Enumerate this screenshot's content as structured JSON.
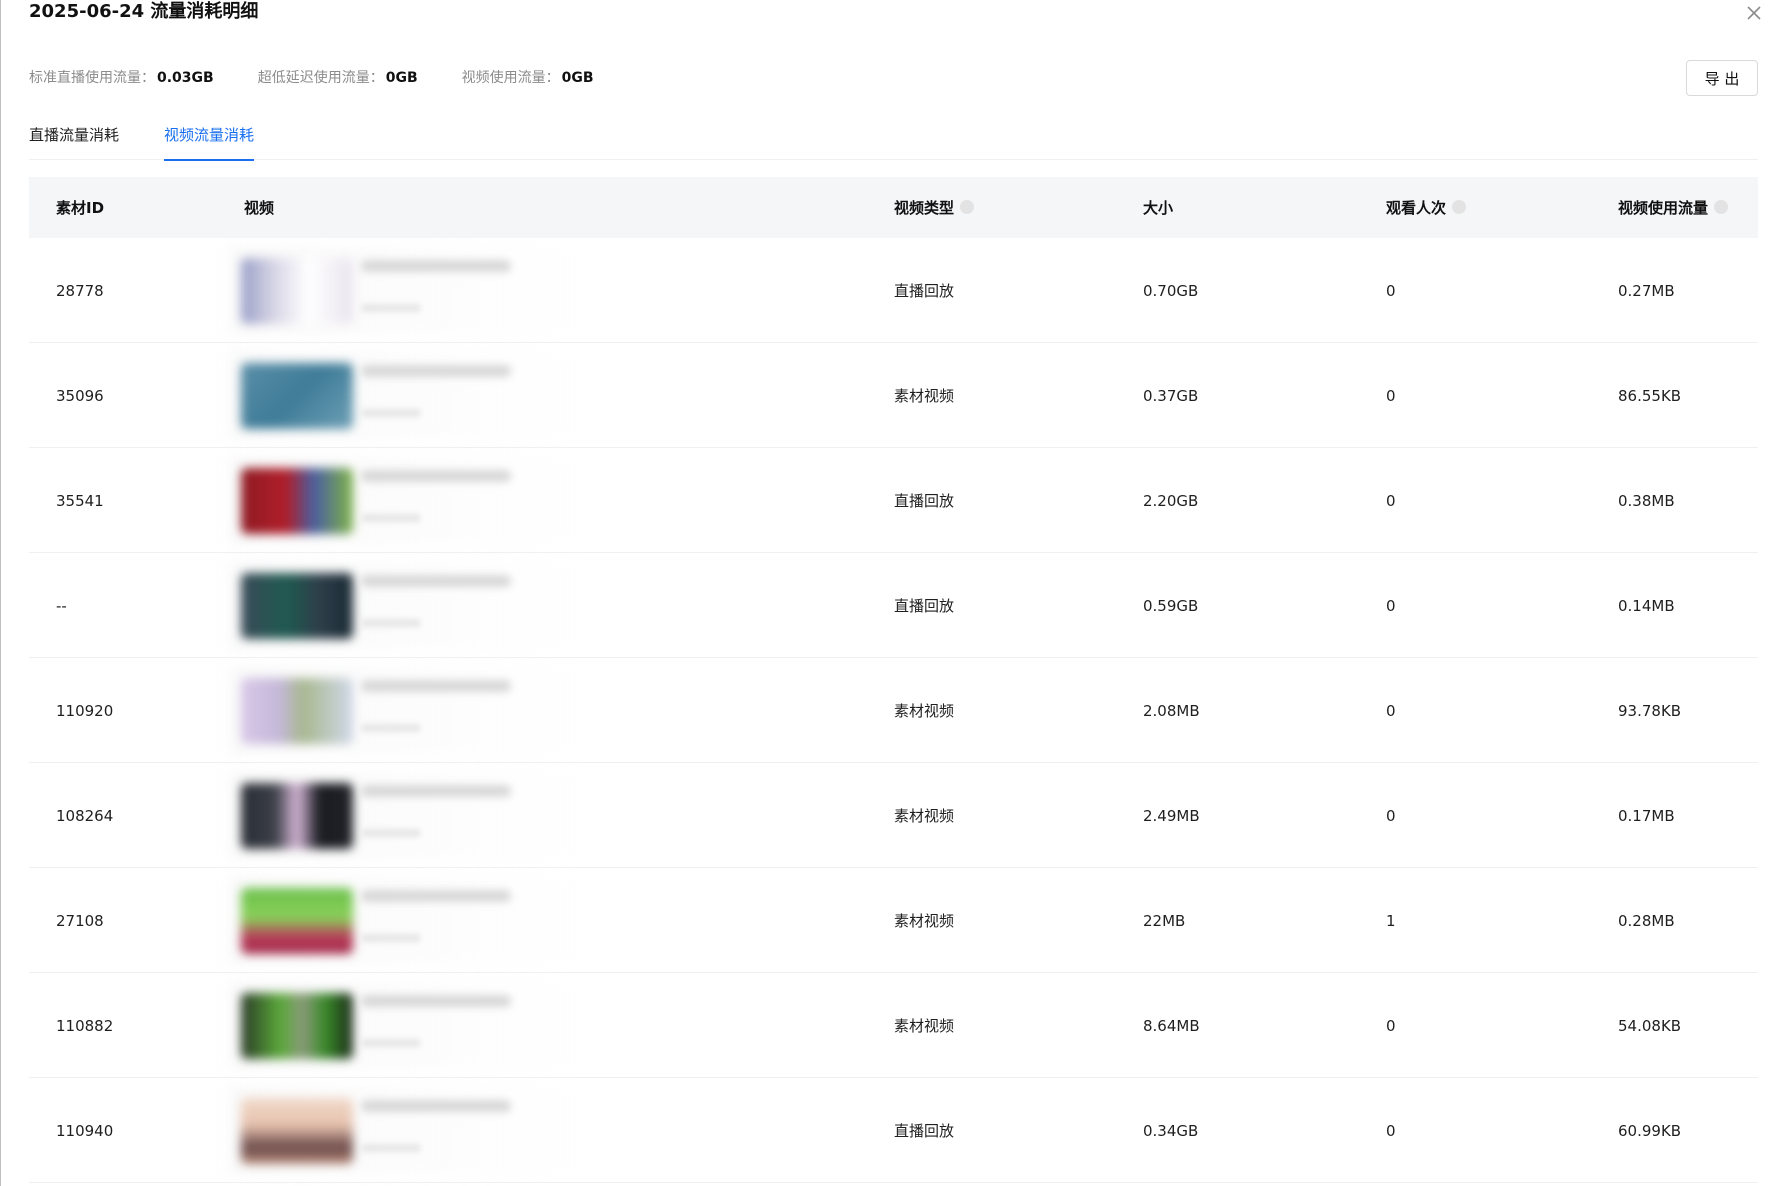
{
  "drawer": {
    "title": "2025-06-24 流量消耗明细",
    "close_icon": "close-icon"
  },
  "summary": [
    {
      "label": "标准直播使用流量：",
      "value": "0.03GB"
    },
    {
      "label": "超低延迟使用流量：",
      "value": "0GB"
    },
    {
      "label": "视频使用流量：",
      "value": "0GB"
    }
  ],
  "export_label": "导 出",
  "tabs": [
    {
      "label": "直播流量消耗",
      "active": false
    },
    {
      "label": "视频流量消耗",
      "active": true
    }
  ],
  "colors": {
    "accent": "#1a6ff0",
    "header_bg": "#f5f6f8"
  },
  "table": {
    "headers": {
      "id": "素材ID",
      "video": "视频",
      "type": "视频类型",
      "size": "大小",
      "views": "观看人次",
      "flow": "视频使用流量"
    },
    "rows": [
      {
        "id": "28778",
        "type": "直播回放",
        "size": "0.70GB",
        "views": "0",
        "flow": "0.27MB",
        "thumb": "linear-gradient(90deg,#9aa0c8 0%,#d8d6e6 30%,#ffffff 60%,#e9e4ee 100%)"
      },
      {
        "id": "35096",
        "type": "素材视频",
        "size": "0.37GB",
        "views": "0",
        "flow": "86.55KB",
        "thumb": "linear-gradient(135deg,#5a8ea8 0%,#3f7c98 50%,#6ea0b6 100%)"
      },
      {
        "id": "35541",
        "type": "直播回放",
        "size": "2.20GB",
        "views": "0",
        "flow": "0.38MB",
        "thumb": "linear-gradient(90deg,#8e1a22 0%,#b01e2a 40%,#4a5fa0 65%,#7fb448 100%)"
      },
      {
        "id": "--",
        "type": "直播回放",
        "size": "0.59GB",
        "views": "0",
        "flow": "0.14MB",
        "thumb": "linear-gradient(90deg,#3a4a58 0%,#1f5a50 40%,#2e3e4a 70%,#1a2a34 100%)"
      },
      {
        "id": "110920",
        "type": "素材视频",
        "size": "2.08MB",
        "views": "0",
        "flow": "93.78KB",
        "thumb": "linear-gradient(90deg,#d8c8e8 0%,#c4b8d8 35%,#a8b890 55%,#d0d8e8 100%)"
      },
      {
        "id": "108264",
        "type": "素材视频",
        "size": "2.49MB",
        "views": "0",
        "flow": "0.17MB",
        "thumb": "linear-gradient(90deg,#2a2e36 0%,#3a3e46 30%,#d6b8d8 50%,#1a1c22 70%,#202228 100%)"
      },
      {
        "id": "27108",
        "type": "素材视频",
        "size": "22MB",
        "views": "1",
        "flow": "0.28MB",
        "thumb": "linear-gradient(180deg,#6ac04a 0%,#8ad05a 45%,#b83a5a 75%,#a02a48 100%)"
      },
      {
        "id": "110882",
        "type": "素材视频",
        "size": "8.64MB",
        "views": "0",
        "flow": "54.08KB",
        "thumb": "linear-gradient(90deg,#2a3a26 0%,#5aa83a 35%,#8a9a7a 55%,#3a8a2a 75%,#1a2a18 100%)"
      },
      {
        "id": "110940",
        "type": "直播回放",
        "size": "0.34GB",
        "views": "0",
        "flow": "60.99KB",
        "thumb": "linear-gradient(180deg,#f0d8c8 0%,#e8c4b0 40%,#6a4a4a 75%,#b88a78 100%)"
      }
    ]
  }
}
